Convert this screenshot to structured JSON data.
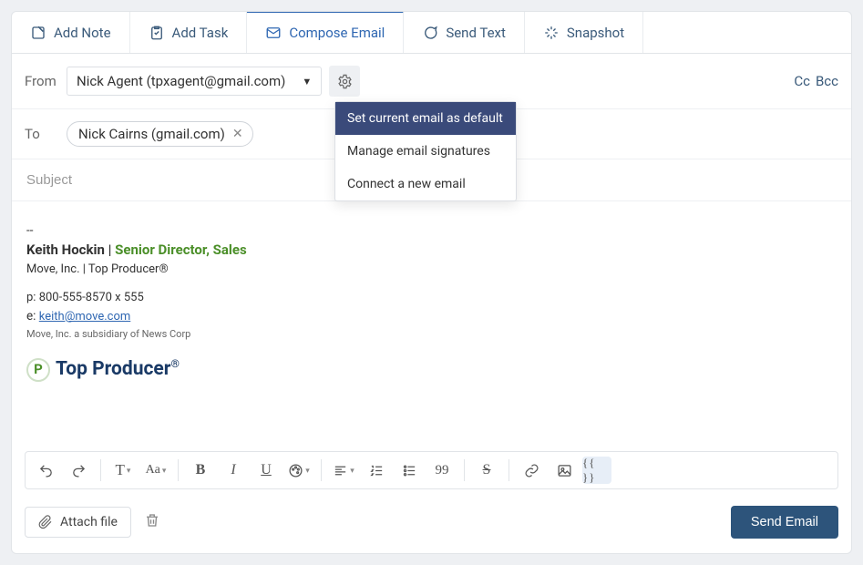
{
  "tabs": {
    "add_note": "Add Note",
    "add_task": "Add Task",
    "compose_email": "Compose Email",
    "send_text": "Send Text",
    "snapshot": "Snapshot"
  },
  "from": {
    "label": "From",
    "value": "Nick Agent (tpxagent@gmail.com)"
  },
  "ccbcc": {
    "cc": "Cc",
    "bcc": "Bcc"
  },
  "to": {
    "label": "To",
    "chip_text": "Nick Cairns (gmail.com)"
  },
  "subject": {
    "placeholder": "Subject"
  },
  "settings_menu": {
    "set_default": "Set current email as default",
    "manage_sig": "Manage email signatures",
    "connect": "Connect a new email"
  },
  "signature": {
    "sep": "--",
    "name": "Keith Hockin",
    "pipe": " | ",
    "title": "Senior Director, Sales",
    "company": "Move, Inc. | Top Producer®",
    "phone_label": "p:  ",
    "phone": "800-555-8570 x 555",
    "email_label": "e:  ",
    "email": "keith@move.com",
    "disclaimer": "Move, Inc. a subsidiary of News Corp",
    "logo_text": "Top Producer",
    "logo_mark": "P",
    "reg": "®"
  },
  "toolbar": {
    "quote": "99",
    "merge": "{{ }}"
  },
  "footer": {
    "attach": "Attach file",
    "send": "Send Email"
  }
}
